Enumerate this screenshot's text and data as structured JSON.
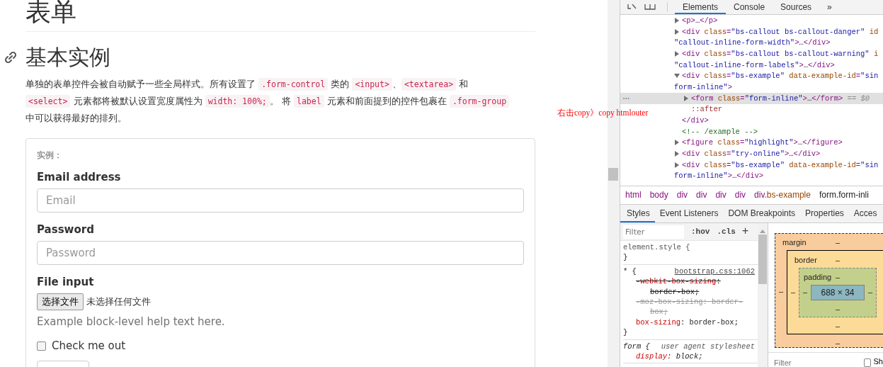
{
  "page": {
    "title": "表单",
    "heading": "基本实例",
    "paragraph": [
      [
        {
          "kind": "text",
          "text": "单独的表单控件会被自动赋予一些全局样式。所有设置了 "
        },
        {
          "kind": "code",
          "text": ".form-control"
        },
        {
          "kind": "text",
          "text": " 类的 "
        },
        {
          "kind": "code",
          "text": "<input>"
        },
        {
          "kind": "text",
          "text": "、"
        },
        {
          "kind": "code",
          "text": "<textarea>"
        },
        {
          "kind": "text",
          "text": " 和"
        }
      ],
      [
        {
          "kind": "code",
          "text": "<select>"
        },
        {
          "kind": "text",
          "text": " 元素都将被默认设置宽度属性为 "
        },
        {
          "kind": "code",
          "text": "width: 100%;"
        },
        {
          "kind": "text",
          "text": "。 将 "
        },
        {
          "kind": "code",
          "text": "label"
        },
        {
          "kind": "text",
          "text": " 元素和前面提到的控件包裹在 "
        },
        {
          "kind": "code",
          "text": ".form-group"
        }
      ],
      [
        {
          "kind": "text",
          "text": "中可以获得最好的排列。"
        }
      ]
    ],
    "example": {
      "caption": "实例：",
      "groups": [
        {
          "kind": "text",
          "label": "Email address",
          "placeholder": "Email"
        },
        {
          "kind": "text",
          "label": "Password",
          "placeholder": "Password"
        },
        {
          "kind": "file",
          "label": "File input",
          "button": "选择文件",
          "status": "未选择任何文件",
          "help": "Example block-level help text here."
        },
        {
          "kind": "checkbox",
          "label": "Check me out",
          "checked": false
        },
        {
          "kind": "button"
        }
      ]
    }
  },
  "annotation": "右击copy》copy htmlouter",
  "devtools": {
    "tabs": [
      {
        "label": "Elements",
        "selected": true
      },
      {
        "label": "Console",
        "selected": false
      },
      {
        "label": "Sources",
        "selected": false
      }
    ],
    "more": "»",
    "dom": {
      "selection_marker": "•••",
      "nodes": [
        {
          "kind": "collapsed",
          "selected": false,
          "lines": [
            [
              {
                "kind": "tag",
                "s": "<p>"
              },
              {
                "kind": "text",
                "s": "…"
              },
              {
                "kind": "tag",
                "s": "</p>"
              }
            ]
          ]
        },
        {
          "kind": "collapsed",
          "selected": false,
          "lines": [
            [
              {
                "kind": "tag",
                "s": "<div "
              },
              {
                "kind": "attr",
                "s": "class"
              },
              {
                "kind": "tag",
                "s": "="
              },
              {
                "kind": "val",
                "s": "\"bs-callout bs-callout-danger\""
              },
              {
                "kind": "attr",
                "s": " id"
              }
            ],
            [
              {
                "kind": "val",
                "s": "\"callout-inline-form-width\""
              },
              {
                "kind": "tag",
                "s": ">"
              },
              {
                "kind": "text",
                "s": "…"
              },
              {
                "kind": "tag",
                "s": "</div>"
              }
            ]
          ]
        },
        {
          "kind": "collapsed",
          "selected": false,
          "lines": [
            [
              {
                "kind": "tag",
                "s": "<div "
              },
              {
                "kind": "attr",
                "s": "class"
              },
              {
                "kind": "tag",
                "s": "="
              },
              {
                "kind": "val",
                "s": "\"bs-callout bs-callout-warning\""
              },
              {
                "kind": "attr",
                "s": " i"
              }
            ],
            [
              {
                "kind": "val",
                "s": "\"callout-inline-form-labels\""
              },
              {
                "kind": "tag",
                "s": ">"
              },
              {
                "kind": "text",
                "s": "…"
              },
              {
                "kind": "tag",
                "s": "</div>"
              }
            ]
          ]
        },
        {
          "kind": "expanded",
          "selected": false,
          "lines": [
            [
              {
                "kind": "tag",
                "s": "<div "
              },
              {
                "kind": "attr",
                "s": "class"
              },
              {
                "kind": "tag",
                "s": "="
              },
              {
                "kind": "val",
                "s": "\"bs-example\""
              },
              {
                "kind": "attr",
                "s": " data-example-id"
              },
              {
                "kind": "tag",
                "s": "="
              },
              {
                "kind": "val",
                "s": "\"sin"
              }
            ],
            [
              {
                "kind": "val",
                "s": "form-inline\""
              },
              {
                "kind": "tag",
                "s": ">"
              }
            ]
          ],
          "children": [
            {
              "kind": "collapsed",
              "selected": true,
              "lines": [
                [
                  {
                    "kind": "tag",
                    "s": "<form "
                  },
                  {
                    "kind": "attr",
                    "s": "class"
                  },
                  {
                    "kind": "tag",
                    "s": "="
                  },
                  {
                    "kind": "val",
                    "s": "\"form-inline\""
                  },
                  {
                    "kind": "tag",
                    "s": ">"
                  },
                  {
                    "kind": "text",
                    "s": "…"
                  },
                  {
                    "kind": "tag",
                    "s": "</form>"
                  },
                  {
                    "kind": "ref",
                    "s": " == $0"
                  }
                ]
              ]
            },
            {
              "kind": "leaf",
              "selected": false,
              "lines": [
                [
                  {
                    "kind": "pseudo",
                    "s": "::after"
                  }
                ]
              ]
            }
          ],
          "closing": [
            {
              "kind": "tag",
              "s": "</div>"
            }
          ]
        },
        {
          "kind": "leaf",
          "selected": false,
          "lines": [
            [
              {
                "kind": "comment",
                "s": "<!-- /example -->"
              }
            ]
          ]
        },
        {
          "kind": "collapsed",
          "selected": false,
          "lines": [
            [
              {
                "kind": "tag",
                "s": "<figure "
              },
              {
                "kind": "attr",
                "s": "class"
              },
              {
                "kind": "tag",
                "s": "="
              },
              {
                "kind": "val",
                "s": "\"highlight\""
              },
              {
                "kind": "tag",
                "s": ">"
              },
              {
                "kind": "text",
                "s": "…"
              },
              {
                "kind": "tag",
                "s": "</figure>"
              }
            ]
          ]
        },
        {
          "kind": "collapsed",
          "selected": false,
          "lines": [
            [
              {
                "kind": "tag",
                "s": "<div "
              },
              {
                "kind": "attr",
                "s": "class"
              },
              {
                "kind": "tag",
                "s": "="
              },
              {
                "kind": "val",
                "s": "\"try-online\""
              },
              {
                "kind": "tag",
                "s": ">"
              },
              {
                "kind": "text",
                "s": "…"
              },
              {
                "kind": "tag",
                "s": "</div>"
              }
            ]
          ]
        },
        {
          "kind": "collapsed",
          "selected": false,
          "lines": [
            [
              {
                "kind": "tag",
                "s": "<div "
              },
              {
                "kind": "attr",
                "s": "class"
              },
              {
                "kind": "tag",
                "s": "="
              },
              {
                "kind": "val",
                "s": "\"bs-example\""
              },
              {
                "kind": "attr",
                "s": " data-example-id"
              },
              {
                "kind": "tag",
                "s": "="
              },
              {
                "kind": "val",
                "s": "\"sin"
              }
            ],
            [
              {
                "kind": "val",
                "s": "form-inline\""
              },
              {
                "kind": "tag",
                "s": ">"
              },
              {
                "kind": "text",
                "s": "…"
              },
              {
                "kind": "tag",
                "s": "</div>"
              }
            ]
          ]
        }
      ]
    },
    "breadcrumbs": [
      {
        "tag": "html",
        "selected": false
      },
      {
        "tag": "body",
        "selected": false
      },
      {
        "tag": "div",
        "selected": false
      },
      {
        "tag": "div",
        "selected": false
      },
      {
        "tag": "div",
        "selected": false
      },
      {
        "tag": "div",
        "selected": false
      },
      {
        "tag": "div",
        "cls": ".bs-example",
        "selected": false
      },
      {
        "tag": "form",
        "cls": ".form-inli",
        "selected": true
      }
    ],
    "subtabs": [
      {
        "label": "Styles",
        "selected": true
      },
      {
        "label": "Event Listeners",
        "selected": false
      },
      {
        "label": "DOM Breakpoints",
        "selected": false
      },
      {
        "label": "Properties",
        "selected": false
      },
      {
        "label": "Acces",
        "selected": false
      }
    ],
    "styles": {
      "filter": {
        "placeholder": "Filter"
      },
      "hov": ":hov",
      "cls": ".cls",
      "add": "+",
      "rules": [
        {
          "selector": "element.style",
          "open": " {",
          "close": "}"
        },
        {
          "selector": "*",
          "open": " {",
          "source": "bootstrap.css:1062",
          "kind": "link",
          "close": "}",
          "props": [
            {
              "name": "-webkit-box-sizing",
              "value": ": border-box;",
              "overridden": true,
              "invalid": false
            },
            {
              "name": "-moz-box-sizing",
              "value": ": border-box;",
              "overridden": true,
              "invalid": true
            },
            {
              "name": "box-sizing",
              "value": ": border-box;",
              "overridden": false,
              "invalid": false
            }
          ]
        },
        {
          "selector": "form",
          "open": " {",
          "source": "user agent stylesheet",
          "kind": "plain",
          "props": [
            {
              "name": "display",
              "value": ": block;",
              "overridden": false,
              "invalid": false
            }
          ]
        }
      ]
    },
    "box_model": {
      "margin": {
        "label": "margin",
        "top": "–",
        "left": "–",
        "bottom": "–"
      },
      "border": {
        "label": "border",
        "top": "–",
        "left": "–",
        "bottom": "–"
      },
      "padding": {
        "label": "padding",
        "top": "–",
        "left": "–",
        "right": "–",
        "bottom": "–"
      },
      "content": "688 × 34"
    },
    "computed": {
      "filter": {
        "placeholder": "Filter"
      },
      "checkbox_label": "Sh",
      "checked": false
    }
  }
}
